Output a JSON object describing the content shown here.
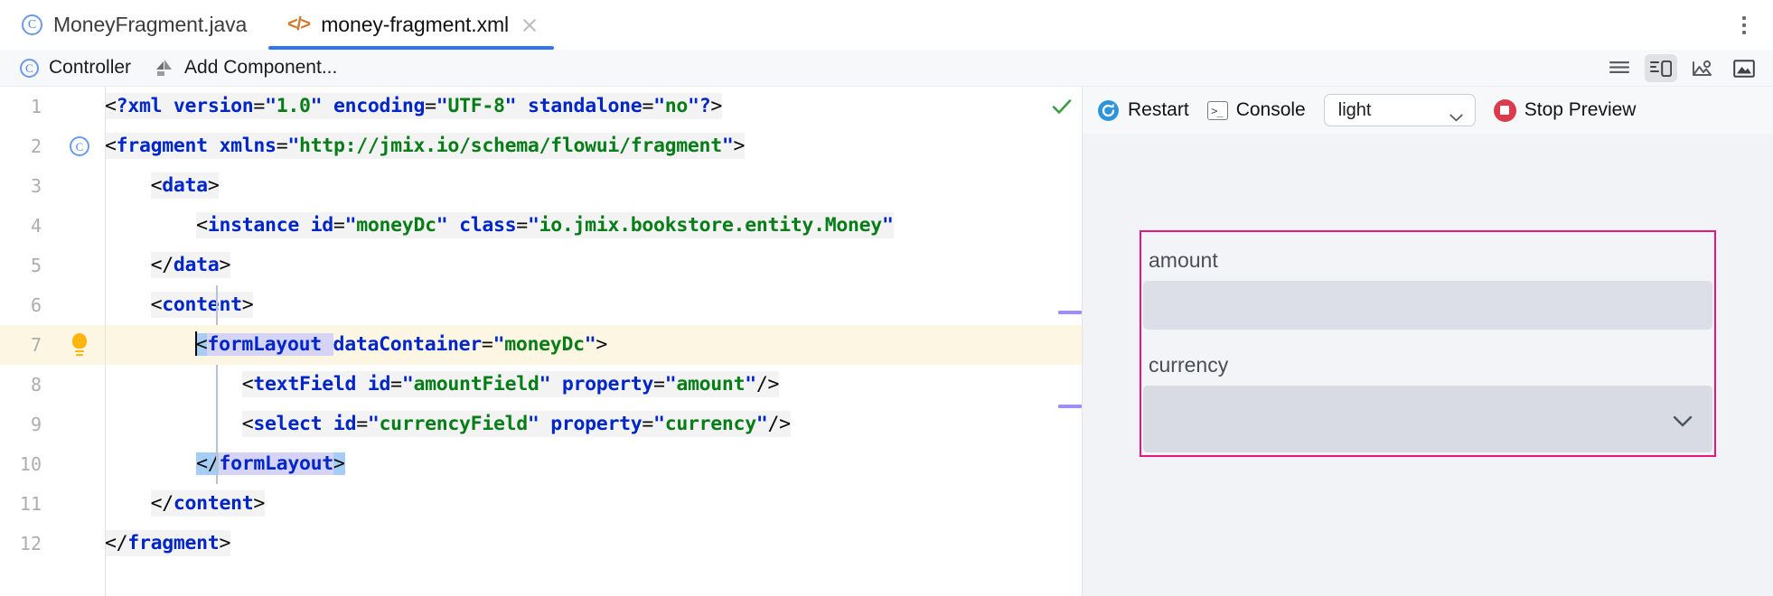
{
  "tabs": [
    {
      "label": "MoneyFragment.java",
      "icon": "java-class-icon",
      "active": false,
      "closable": false
    },
    {
      "label": "money-fragment.xml",
      "icon": "xml-file-icon",
      "active": true,
      "closable": true
    }
  ],
  "window": {
    "kebab_icon": "more-options-icon"
  },
  "toolbar": {
    "controller_label": "Controller",
    "controller_icon": "java-class-icon",
    "add_component_label": "Add Component...",
    "add_component_icon": "add-component-icon",
    "view_modes": [
      {
        "name": "code-view-icon",
        "selected": false
      },
      {
        "name": "split-view-icon",
        "selected": true
      },
      {
        "name": "preview-view-icon",
        "selected": false
      },
      {
        "name": "design-view-icon",
        "selected": false
      }
    ]
  },
  "editor": {
    "status_icon": "inspection-ok-check",
    "status_color": "#3f9d41",
    "highlighted_line": 7,
    "bulb_line": 7,
    "gutter_controller_line": 2,
    "marker_color": "#a08df5",
    "lines": [
      {
        "n": "1",
        "text": "<?xml version=\"1.0\" encoding=\"UTF-8\" standalone=\"no\"?>"
      },
      {
        "n": "2",
        "text": "<fragment xmlns=\"http://jmix.io/schema/flowui/fragment\">"
      },
      {
        "n": "3",
        "text": "    <data>"
      },
      {
        "n": "4",
        "text": "        <instance id=\"moneyDc\" class=\"io.jmix.bookstore.entity.Money\""
      },
      {
        "n": "5",
        "text": "    </data>"
      },
      {
        "n": "6",
        "text": "    <content>"
      },
      {
        "n": "7",
        "text": "        <formLayout dataContainer=\"moneyDc\">"
      },
      {
        "n": "8",
        "text": "            <textField id=\"amountField\" property=\"amount\"/>"
      },
      {
        "n": "9",
        "text": "            <select id=\"currencyField\" property=\"currency\"/>"
      },
      {
        "n": "10",
        "text": "        </formLayout>"
      },
      {
        "n": "11",
        "text": "    </content>"
      },
      {
        "n": "12",
        "text": "</fragment>"
      }
    ],
    "colors": {
      "tag": "#0026c9",
      "attribute": "#0026c9",
      "value": "#067d17",
      "punctuation": "#0a0a0a",
      "highlight_row": "#fdf6e3",
      "selection": "#d5d4f7"
    }
  },
  "preview": {
    "restart_label": "Restart",
    "restart_icon": "restart-icon",
    "console_label": "Console",
    "console_icon": "console-icon",
    "theme_value": "light",
    "theme_chevron_icon": "chevron-down-icon",
    "stop_label": "Stop Preview",
    "stop_icon": "stop-icon",
    "form": {
      "border_color": "#e6177f",
      "fields": [
        {
          "label": "amount",
          "type": "textfield"
        },
        {
          "label": "currency",
          "type": "select",
          "chevron_icon": "chevron-down-icon"
        }
      ]
    }
  }
}
